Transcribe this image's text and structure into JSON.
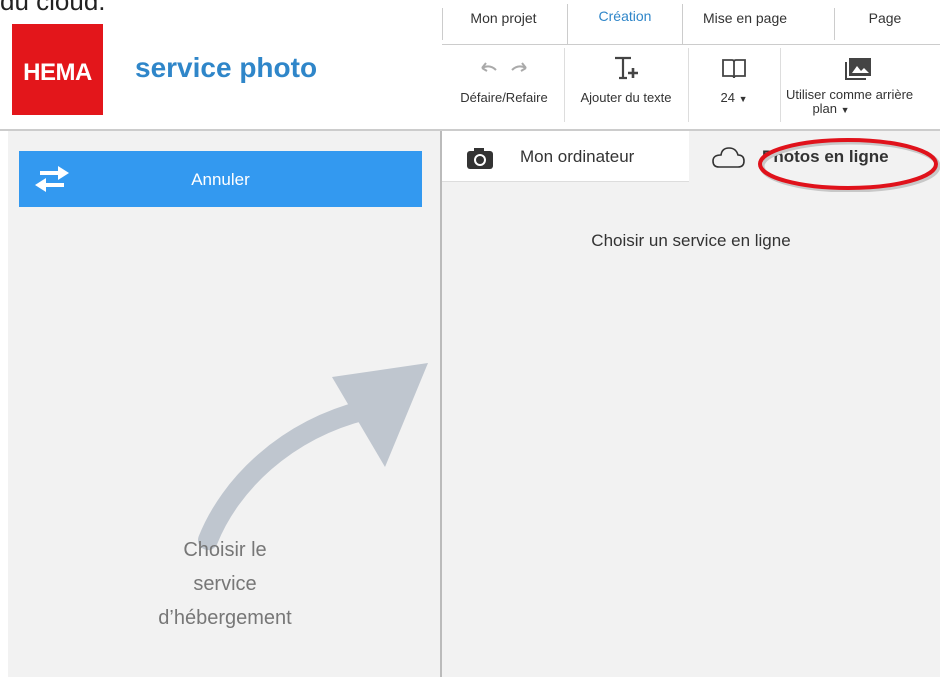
{
  "caption_fragment": "du cloud.",
  "brand": {
    "logo_text": "HEMA",
    "title": "service photo"
  },
  "tabs": [
    {
      "label": "Mon projet"
    },
    {
      "label": "Création"
    },
    {
      "label": "Mise en page"
    },
    {
      "label": "Page"
    }
  ],
  "toolbar": {
    "undo_redo_label": "Défaire/Refaire",
    "add_text_label": "Ajouter du texte",
    "pages_value": "24",
    "background_label_line1": "Utiliser comme arrière",
    "background_label_line2": "plan"
  },
  "left_panel": {
    "cancel_label": "Annuler",
    "hint_line1": "Choisir le",
    "hint_line2": "service",
    "hint_line3": "d’hébergement"
  },
  "source_tabs": {
    "computer_label": "Mon ordinateur",
    "online_label": "Photos en ligne"
  },
  "right_panel": {
    "prompt": "Choisir un service en ligne"
  },
  "colors": {
    "brand_red": "#e3161b",
    "brand_blue": "#2f86c9",
    "button_blue": "#3399f0",
    "highlight": "#e0121b"
  },
  "icons": [
    "undo-icon",
    "redo-icon",
    "add-text-icon",
    "book-icon",
    "image-icon",
    "swap-arrows-icon",
    "camera-icon",
    "cloud-icon",
    "pointer-arrow-icon"
  ]
}
